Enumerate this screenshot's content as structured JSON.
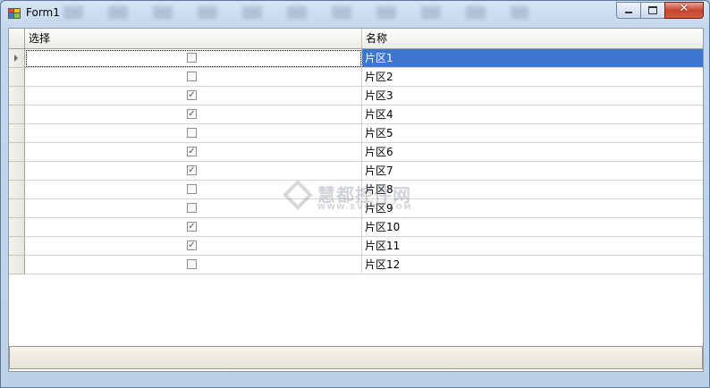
{
  "window": {
    "title": "Form1",
    "minimize_icon": "minimize-icon",
    "maximize_icon": "maximize-icon",
    "close_glyph": "✕"
  },
  "grid": {
    "columns": [
      "选择",
      "名称"
    ],
    "rows": [
      {
        "checked": false,
        "name": "片区1"
      },
      {
        "checked": false,
        "name": "片区2"
      },
      {
        "checked": true,
        "name": "片区3"
      },
      {
        "checked": true,
        "name": "片区4"
      },
      {
        "checked": false,
        "name": "片区5"
      },
      {
        "checked": true,
        "name": "片区6"
      },
      {
        "checked": true,
        "name": "片区7"
      },
      {
        "checked": false,
        "name": "片区8"
      },
      {
        "checked": false,
        "name": "片区9"
      },
      {
        "checked": true,
        "name": "片区10"
      },
      {
        "checked": true,
        "name": "片区11"
      },
      {
        "checked": false,
        "name": "片区12"
      }
    ],
    "selected_row": 0,
    "check_mark": "✓",
    "selection_color": "#3c76d2"
  },
  "watermark": {
    "main": "慧都控件网",
    "sub": "WWW.EVGET.COM"
  }
}
